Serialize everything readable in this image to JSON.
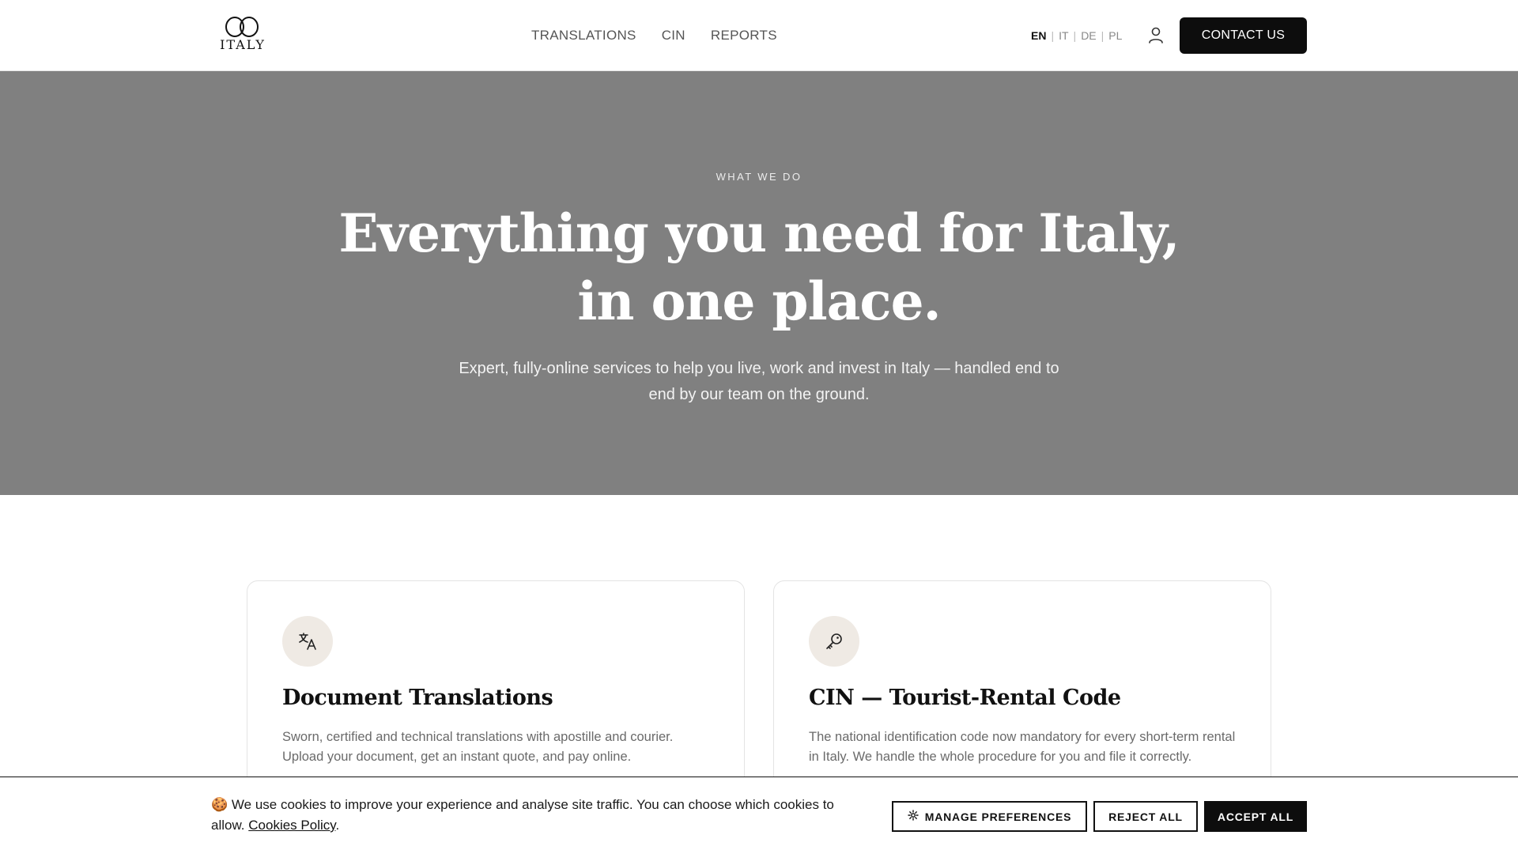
{
  "header": {
    "logo_text": "ITALY",
    "nav": [
      "TRANSLATIONS",
      "CIN",
      "REPORTS"
    ],
    "languages": [
      "EN",
      "IT",
      "DE",
      "PL"
    ],
    "active_language": "EN",
    "contact_label": "CONTACT US"
  },
  "hero": {
    "eyebrow": "WHAT WE DO",
    "title": "Everything you need for Italy, in one place.",
    "subtitle": "Expert, fully-online services to help you live, work and invest in Italy — handled end to end by our team on the ground.",
    "background": "#808080"
  },
  "cards": [
    {
      "icon": "translate-icon",
      "title": "Document Translations",
      "text": "Sworn, certified and technical translations with apostille and courier. Upload your document, get an instant quote, and pay online."
    },
    {
      "icon": "key-icon",
      "title": "CIN — Tourist-Rental Code",
      "text": "The national identification code now mandatory for every short-term rental in Italy. We handle the whole procedure for you and file it correctly."
    }
  ],
  "cookie_banner": {
    "emoji": "🍪",
    "text": "We use cookies to improve your experience and analyse site traffic. You can choose which cookies to allow.",
    "policy_link": "Cookies Policy",
    "manage_label": "MANAGE PREFERENCES",
    "reject_label": "REJECT ALL",
    "accept_label": "ACCEPT ALL"
  }
}
